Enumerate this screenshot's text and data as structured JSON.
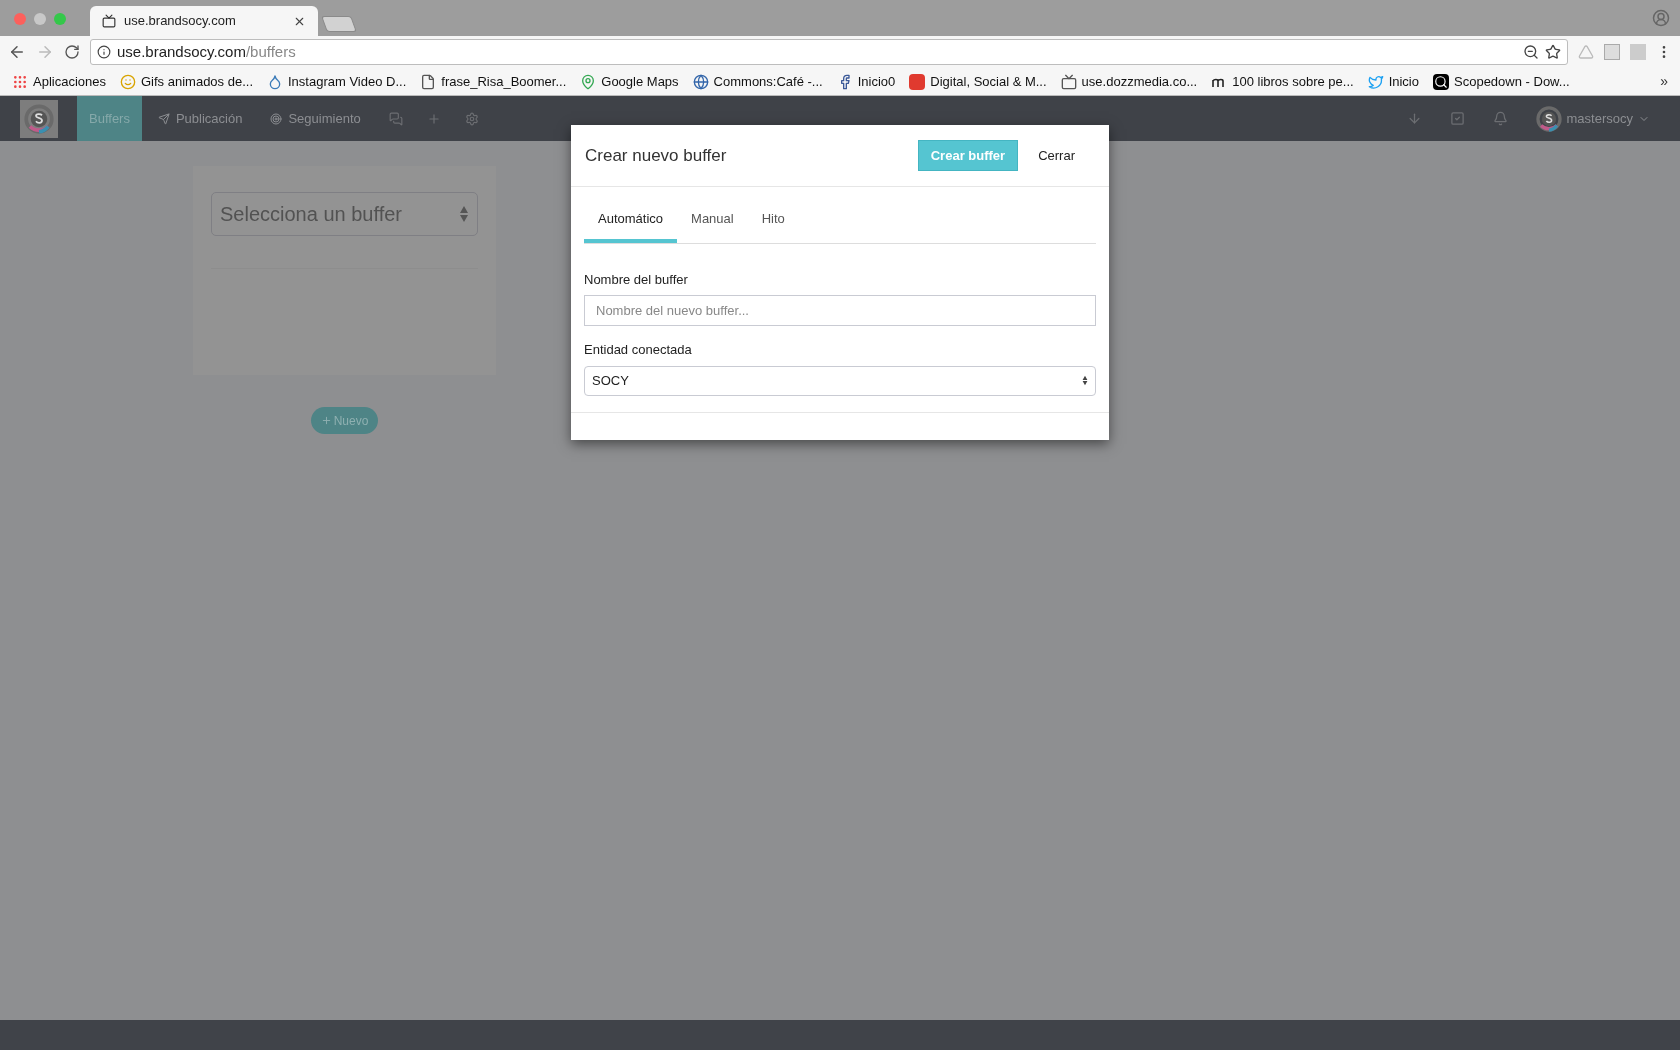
{
  "browser": {
    "tabs": [
      {
        "title": "use.brandsocy.com",
        "selected": true
      }
    ],
    "url": {
      "host": "use.brandsocy.com",
      "path": "/buffers"
    },
    "bookmarks": [
      {
        "label": "Aplicaciones"
      },
      {
        "label": "Gifs animados de..."
      },
      {
        "label": "Instagram Video D..."
      },
      {
        "label": "frase_Risa_Boomer..."
      },
      {
        "label": "Google Maps"
      },
      {
        "label": "Commons:Café -..."
      },
      {
        "label": "Inicio0"
      },
      {
        "label": "Digital, Social & M..."
      },
      {
        "label": "use.dozzmedia.co..."
      },
      {
        "label": "100 libros sobre pe..."
      },
      {
        "label": "Inicio"
      },
      {
        "label": "Scopedown - Dow..."
      }
    ],
    "more": "»"
  },
  "nav": {
    "items": [
      {
        "label": "Buffers",
        "selected": true
      },
      {
        "label": "Publicación",
        "selected": false
      },
      {
        "label": "Seguimiento",
        "selected": false
      }
    ],
    "user": "mastersocy"
  },
  "panel": {
    "select": "Selecciona un buffer",
    "new_button": "Nuevo"
  },
  "modal": {
    "title": "Crear nuevo buffer",
    "primary": "Crear buffer",
    "close": "Cerrar",
    "tabs": [
      {
        "label": "Automático",
        "selected": true
      },
      {
        "label": "Manual",
        "selected": false
      },
      {
        "label": "Hito",
        "selected": false
      }
    ],
    "fields": [
      {
        "kind": "text",
        "label": "Nombre del buffer",
        "placeholder": "Nombre del nuevo buffer..."
      },
      {
        "kind": "select",
        "label": "Entidad conectada",
        "value": "SOCY"
      }
    ]
  }
}
